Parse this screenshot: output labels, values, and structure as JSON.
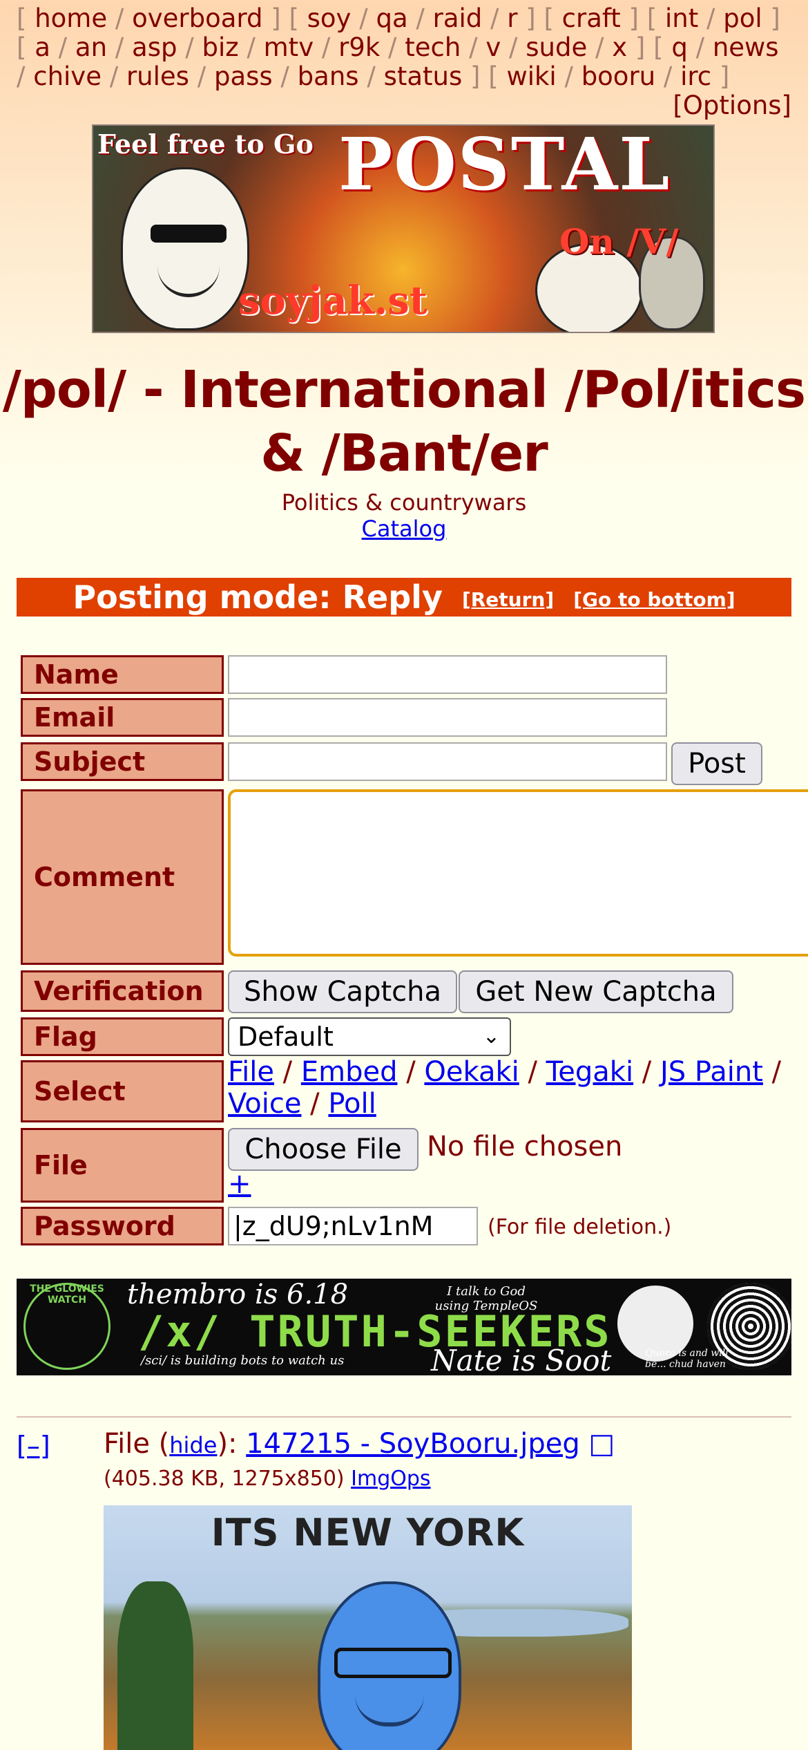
{
  "nav": {
    "groups": [
      [
        "home",
        "overboard"
      ],
      [
        "soy",
        "qa",
        "raid",
        "r"
      ],
      [
        "craft"
      ],
      [
        "int",
        "pol"
      ],
      [
        "a",
        "an",
        "asp",
        "biz",
        "mtv",
        "r9k",
        "tech",
        "v",
        "sude",
        "x"
      ],
      [
        "q",
        "news",
        "chive",
        "rules",
        "pass",
        "bans",
        "status"
      ],
      [
        "wiki",
        "booru",
        "irc"
      ]
    ],
    "options_label": "[Options]"
  },
  "banner": {
    "line1": "Feel free to Go",
    "line2": "POSTAL",
    "line3": "On /V/",
    "line4": "soyjak.st"
  },
  "board": {
    "title": "/pol/ - International /Pol/itics & /Bant/er",
    "subtitle": "Politics & countrywars",
    "catalog_label": "Catalog"
  },
  "posting_mode": {
    "label": "Posting mode: Reply",
    "return_label": "[Return]",
    "bottom_label": "[Go to bottom]"
  },
  "form": {
    "name_label": "Name",
    "email_label": "Email",
    "subject_label": "Subject",
    "post_button": "Post",
    "comment_label": "Comment",
    "verification_label": "Verification",
    "show_captcha": "Show Captcha",
    "new_captcha": "Get New Captcha",
    "flag_label": "Flag",
    "flag_value": "Default",
    "select_label": "Select",
    "select_options": [
      "File",
      "Embed",
      "Oekaki",
      "Tegaki",
      "JS Paint",
      "Voice",
      "Poll"
    ],
    "file_label": "File",
    "choose_file": "Choose File",
    "no_file": "No file chosen",
    "add_more": "+",
    "password_label": "Password",
    "password_value": "|z_dU9;nLv1nM",
    "password_note": "(For file deletion.)"
  },
  "ad": {
    "top_left": "thembro is 6.18",
    "main": "/x/ TRUTH-SEEKERS",
    "bottom_right": "Nate is Soot",
    "bottom_left": "/sci/ is building bots to watch us",
    "top_right": "I talk to God using TempleOS",
    "corner": "Quora is and will be... chud haven",
    "badge": "THE GLOWIES WATCH"
  },
  "post": {
    "collapse": "[–]",
    "file_prefix": "File (",
    "hide_label": "hide",
    "file_mid": "): ",
    "filename": "147215 - SoyBooru.jpeg",
    "file_icon": "external-link-icon",
    "meta": "(405.38 KB, 1275x850)",
    "imgops": "ImgOps",
    "image_caption": "ITS NEW YORK"
  }
}
